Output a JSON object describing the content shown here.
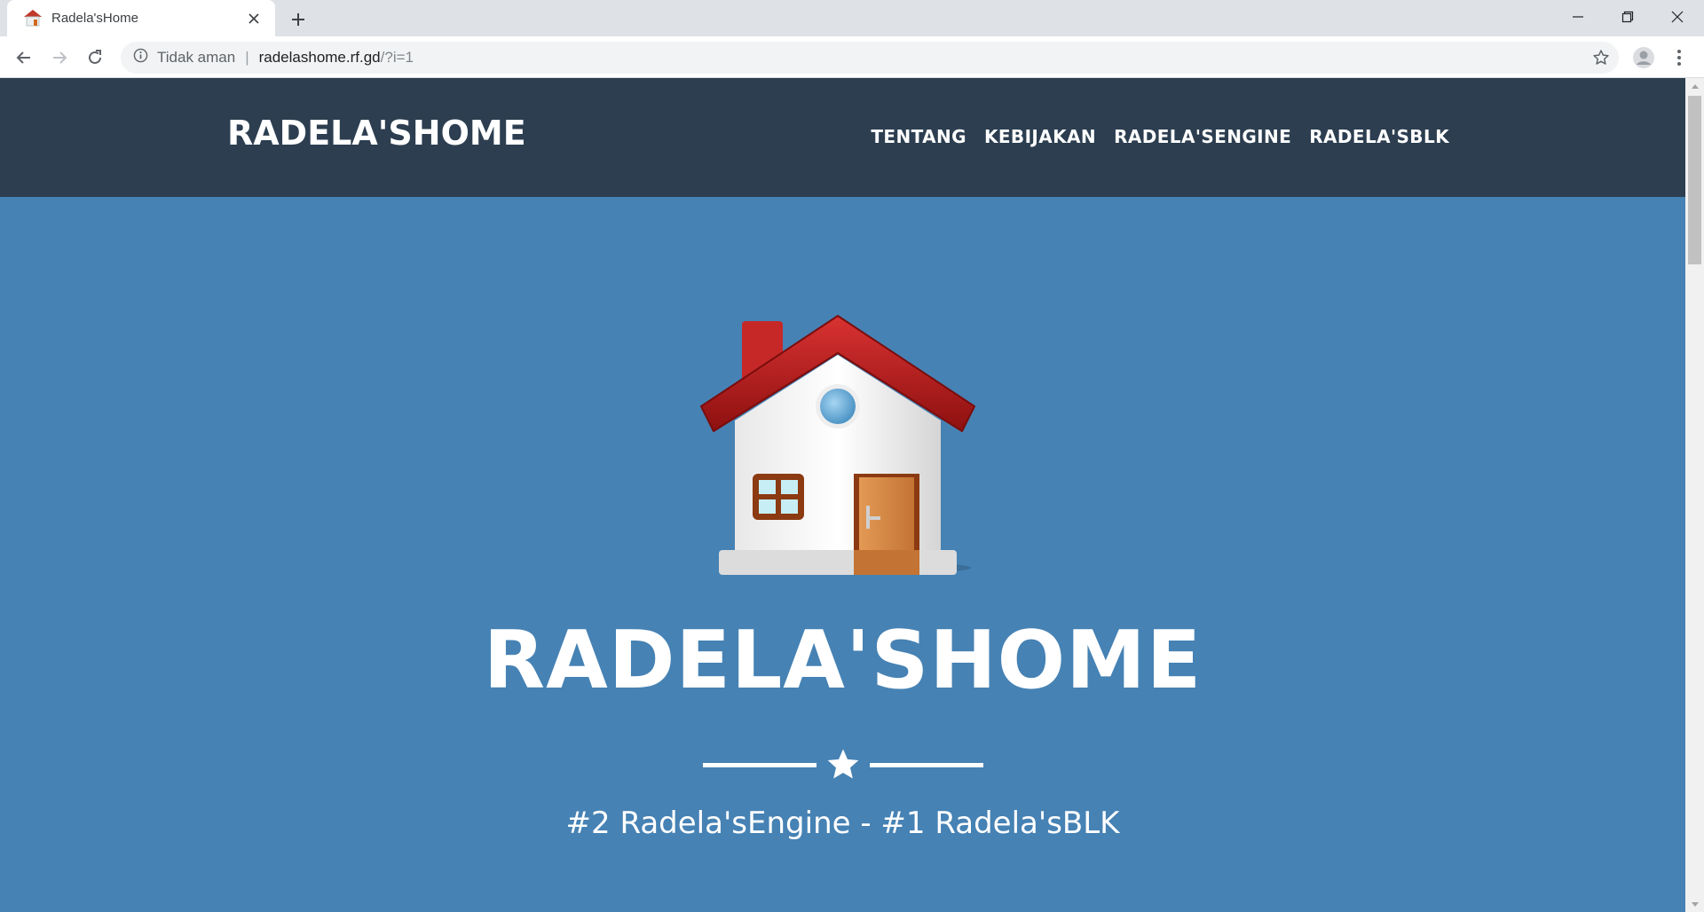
{
  "browser": {
    "tab_title": "Radela'sHome",
    "security_text": "Tidak aman",
    "url_host": "radelashome.rf.gd",
    "url_path": "/?i=1"
  },
  "site": {
    "brand": "RADELA'SHOME",
    "nav": [
      "TENTANG",
      "KEBIJAKAN",
      "RADELA'SENGINE",
      "RADELA'SBLK"
    ],
    "hero_title": "RADELA'SHOME",
    "tagline": "#2 Radela'sEngine - #1 Radela'sBLK"
  },
  "colors": {
    "nav_bg": "#2c3e50",
    "hero_bg": "#4682b4",
    "text": "#ffffff"
  },
  "icons": [
    "house-favicon",
    "close-icon",
    "plus-icon",
    "minimize-icon",
    "restore-icon",
    "window-close-icon",
    "back-arrow-icon",
    "forward-arrow-icon",
    "reload-icon",
    "info-icon",
    "bookmark-star-icon",
    "profile-avatar-icon",
    "kebab-menu-icon",
    "house-icon",
    "star-icon"
  ]
}
